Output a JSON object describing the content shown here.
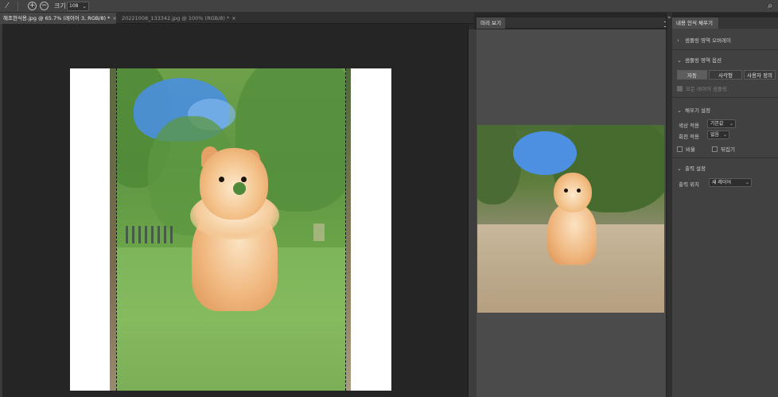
{
  "toolbar": {
    "zoom_in_symbol": "+",
    "zoom_out_symbol": "−",
    "size_label": "크기",
    "size_value": "108",
    "dropdown_chevron": "⌄"
  },
  "tabs": [
    {
      "label": "해조현식용.jpg @ 65.7% (레이어 3, RGB/8) *",
      "close": "×"
    },
    {
      "label": "20221008_133342.jpg @ 100% (RGB/8) *",
      "close": "×"
    }
  ],
  "preview": {
    "tab_label": "미리 보기"
  },
  "panel": {
    "tab_label": "내용 인식 채우기",
    "sections": {
      "sampling_overlay": "샘플링 영역 오버레이",
      "sampling_options": "샘플링 영역 옵션",
      "fill_settings": "채우기 설정",
      "output_settings": "출력 설정"
    },
    "sampling_buttons": [
      "자동",
      "사각형",
      "사용자 정의"
    ],
    "sample_all_layers": "모든 레이어 샘플링",
    "color_adapt": {
      "label": "색상 적용",
      "value": "기본값"
    },
    "rotation_adapt": {
      "label": "회전 적용",
      "value": "없음"
    },
    "scale": "비율",
    "mirror": "뒤집기",
    "output_to": {
      "label": "출력 위치",
      "value": "새 레이어"
    },
    "caret_open": "⌄",
    "caret_closed": "›",
    "dropdown_chevron": "⌄"
  },
  "icons": {
    "brush_tool": "brush-icon",
    "zoom_in": "zoom-in-icon",
    "zoom_out": "zoom-out-icon",
    "search": "search-icon",
    "panel_menu": "panel-menu-icon",
    "collapse": "double-chevron-icon"
  },
  "colors": {
    "app_bg": "#262626",
    "panel_bg": "#414141",
    "overlay_green": "#6fa14a"
  }
}
